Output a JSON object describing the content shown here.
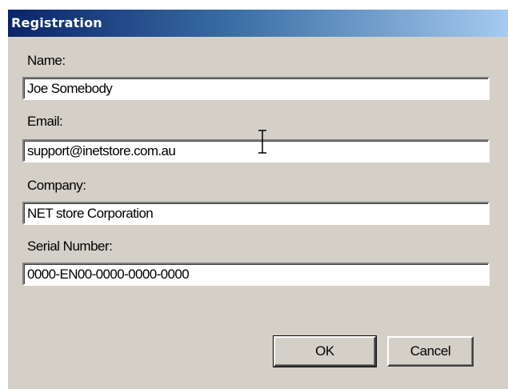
{
  "dialog": {
    "title": "Registration",
    "fields": [
      {
        "label": "Name:",
        "value": "Joe Somebody"
      },
      {
        "label": "Email:",
        "value": "support@inetstore.com.au"
      },
      {
        "label": "Company:",
        "value": "NET store Corporation"
      },
      {
        "label": "Serial Number:",
        "value": "0000-EN00-0000-0000-0000"
      }
    ],
    "buttons": {
      "ok_label": "OK",
      "cancel_label": "Cancel"
    },
    "cursor_icon": "text-cursor-icon"
  },
  "colors": {
    "title_bar_start": "#0a246a",
    "title_bar_end": "#a6caf0",
    "dialog_face": "#d4d0c8",
    "field_background": "#ffffff"
  }
}
